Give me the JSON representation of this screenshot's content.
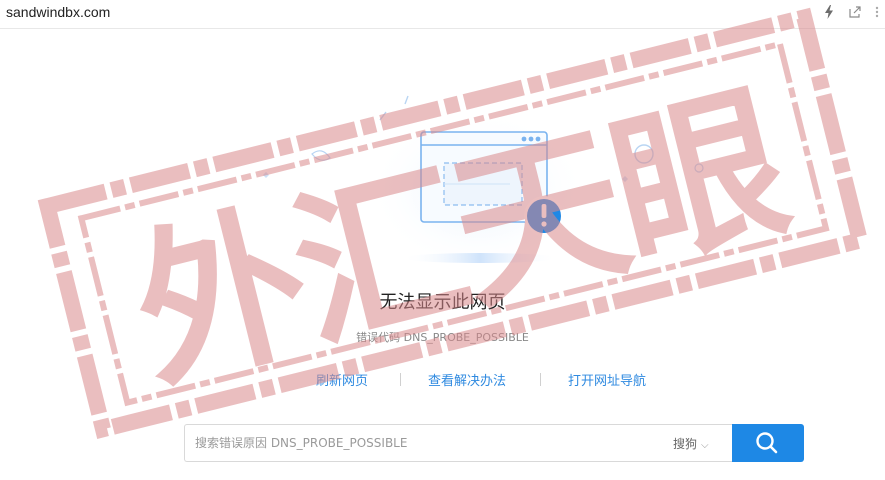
{
  "browser": {
    "url": "sandwindbx.com",
    "icons": [
      "lightning-icon",
      "share-icon",
      "more-icon"
    ]
  },
  "error": {
    "title": "无法显示此网页",
    "code_line": "错误代码 DNS_PROBE_POSSIBLE"
  },
  "actions": {
    "refresh": "刷新网页",
    "solutions": "查看解决办法",
    "nav": "打开网址导航"
  },
  "search": {
    "placeholder": "搜索错误原因 DNS_PROBE_POSSIBLE",
    "engine": "搜狗",
    "engine_arrow": "⌵"
  },
  "watermark": {
    "text": "外汇天眼",
    "color": "#d9898c"
  },
  "colors": {
    "link": "#2f8ae0",
    "button": "#1e88e5",
    "alert": "#1e88e5"
  }
}
